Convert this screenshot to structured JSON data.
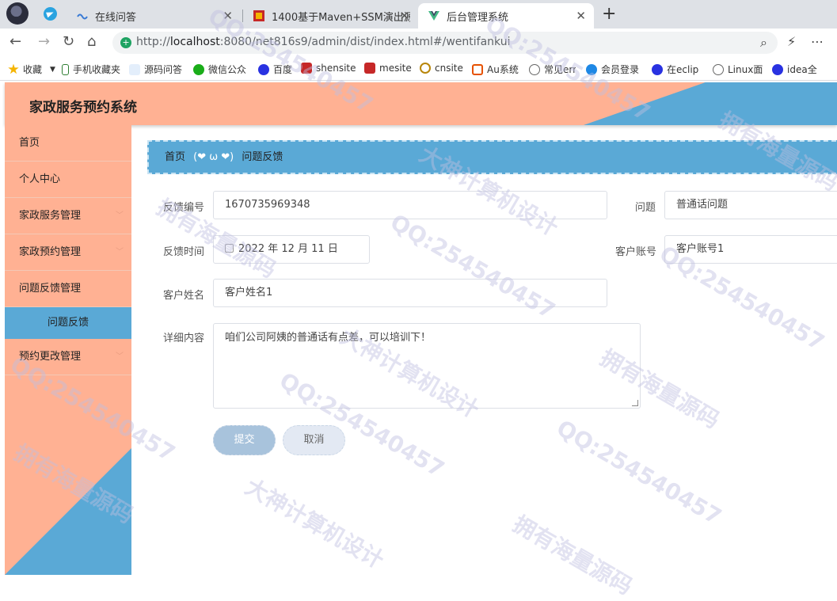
{
  "browser": {
    "tabs": [
      {
        "title": "在线问答",
        "active": false
      },
      {
        "title": "1400基于Maven+SSM演出源",
        "active": false
      },
      {
        "title": "后台管理系统",
        "active": true
      }
    ],
    "url_prefix": "http://",
    "url_host": "localhost",
    "url_rest": ":8080/net816s9/admin/dist/index.html#/wentifankui",
    "bookmarks": [
      "收藏",
      "手机收藏夹",
      "源码问答",
      "微信公众",
      "百度",
      "shensite",
      "mesite",
      "cnsite",
      "Au系统",
      "常见err",
      "会员登录",
      "在eclip",
      "Linux面",
      "idea全"
    ]
  },
  "app": {
    "title": "家政服务预约系统"
  },
  "sidebar": {
    "items": [
      {
        "label": "首页",
        "chevron": ""
      },
      {
        "label": "个人中心",
        "chevron": ""
      },
      {
        "label": "家政服务管理",
        "chevron": "﹀"
      },
      {
        "label": "家政预约管理",
        "chevron": "﹀"
      },
      {
        "label": "问题反馈管理",
        "chevron": ""
      },
      {
        "label": "预约更改管理",
        "chevron": "﹀"
      }
    ],
    "active_sub": "问题反馈"
  },
  "breadcrumb": {
    "home": "首页",
    "separator": "(❤ ω ❤)",
    "current": "问题反馈"
  },
  "form": {
    "feedback_no_label": "反馈编号",
    "feedback_no_value": "1670735969348",
    "question_label": "问题",
    "question_value": "普通话问题",
    "feedback_time_label": "反馈时间",
    "feedback_time_value": "2022 年 12 月 11 日",
    "account_label": "客户账号",
    "account_value": "客户账号1",
    "name_label": "客户姓名",
    "name_value": "客户姓名1",
    "detail_label": "详细内容",
    "detail_value": "咱们公司阿姨的普通话有点差，可以培训下！",
    "submit_label": "提交",
    "cancel_label": "取消"
  },
  "watermark": {
    "lines": [
      "QQ:254540457",
      "拥有海量源码",
      "大神计算机设计"
    ]
  },
  "colors": {
    "peach": "#ffb193",
    "blue": "#5aa9d6"
  }
}
